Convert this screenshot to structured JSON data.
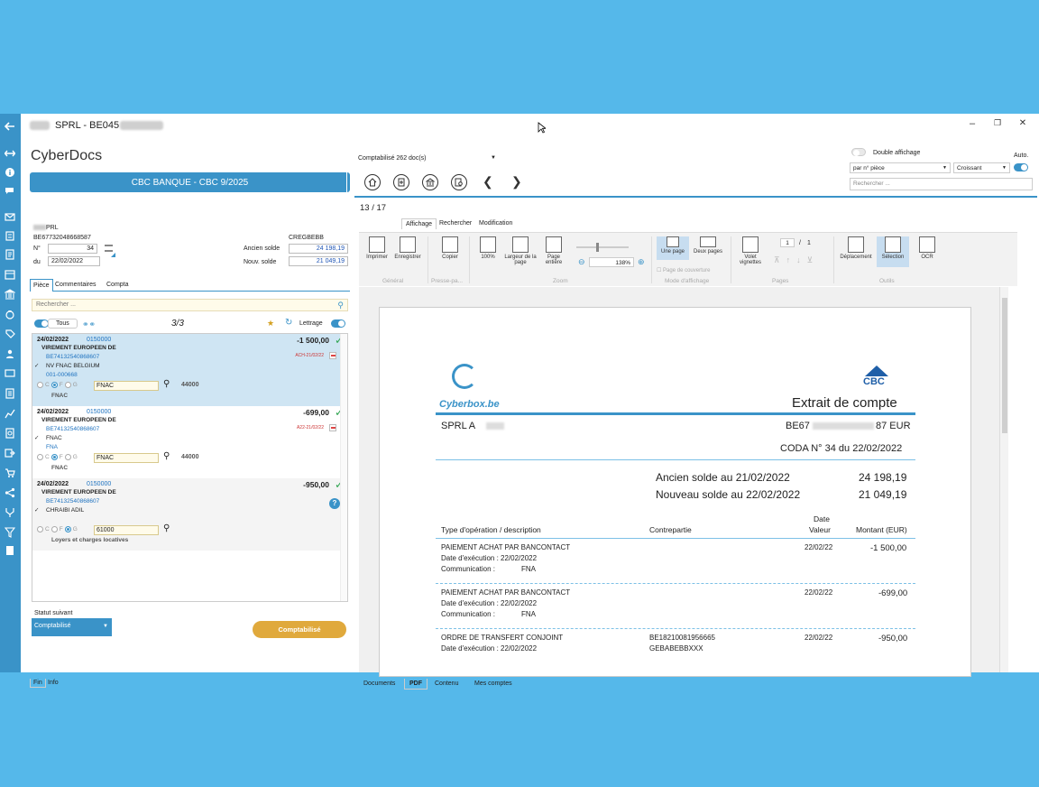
{
  "window": {
    "title_mid": "SPRL - BE045",
    "btn_min": "–",
    "btn_max": "❐",
    "btn_close": "✕"
  },
  "app_name": "CyberDocs",
  "journal": "CBC BANQUE - CBC 9/2025",
  "account": {
    "name": "PRL",
    "iban": "BE67732048668587",
    "bic": "CREGBEBB",
    "no_label": "N°",
    "no_value": "34",
    "du_label": "du",
    "du_value": "22/02/2022",
    "ancien_label": "Ancien solde",
    "ancien_value": "24 198,19",
    "nouv_label": "Nouv. solde",
    "nouv_value": "21 049,19"
  },
  "tabs": [
    "Pièce",
    "Commentaires",
    "Compta"
  ],
  "search_placeholder": "Rechercher ...",
  "filter": {
    "tous": "Tous",
    "counter": "3/3",
    "lettrage": "Lettrage"
  },
  "entries": [
    {
      "date": "24/02/2022",
      "ref": "0150000",
      "amount": "-1 500,00",
      "line1": "VIREMENT EUROPEEN DE",
      "line2": "BE74132540868607",
      "line3": "NV FNAC BELGIUM",
      "line4": "001-000668",
      "tag": "ACH-21/02/22",
      "c": "C",
      "f": "F",
      "g": "G",
      "account": "FNAC",
      "account_no": "44000",
      "label": "FNAC"
    },
    {
      "date": "24/02/2022",
      "ref": "0150000",
      "amount": "-699,00",
      "line1": "VIREMENT EUROPEEN DE",
      "line2": "BE74132540868607",
      "line3": "FNAC",
      "line4": "FNA",
      "tag": "A22-21/02/22",
      "c": "C",
      "f": "F",
      "g": "G",
      "account": "FNAC",
      "account_no": "44000",
      "label": "FNAC"
    },
    {
      "date": "24/02/2022",
      "ref": "0150000",
      "amount": "-950,00",
      "line1": "VIREMENT EUROPEEN DE",
      "line2": "BE74132540868607",
      "line3": "CHRAIBI ADIL",
      "c": "C",
      "f": "F",
      "g": "G",
      "account": "61000",
      "label": "Loyers et charges locatives"
    }
  ],
  "statut": {
    "label": "Statut suivant",
    "value": "Comptabilisé",
    "button": "Comptabilisé"
  },
  "footer_tabs": [
    "Fin",
    "Info"
  ],
  "doccount": "Comptabilisé 262 doc(s)",
  "pagecount": "13 / 17",
  "ribbon_tabs": [
    "Affichage",
    "Rechercher",
    "Modification"
  ],
  "ribbon": {
    "imprimer": "Imprimer",
    "enregistrer": "Enregistrer",
    "copier": "Copier",
    "p100": "100%",
    "largeur": "Largeur de la page",
    "entiere": "Page entière",
    "zoom_value": "138%",
    "une_page": "Une page",
    "deux_pages": "Deux pages",
    "couverture": "Page de couverture",
    "volet": "Volet vignettes",
    "page_num": "1",
    "page_total": "1",
    "deplacement": "Déplacement",
    "selection": "Sélection",
    "ocr": "OCR",
    "g_general": "Général",
    "g_presse": "Presse-pa...",
    "g_zoom": "Zoom",
    "g_mode": "Mode d'affichage",
    "g_pages": "Pages",
    "g_outils": "Outils"
  },
  "rightpanel": {
    "double": "Double affichage",
    "auto": "Auto.",
    "sort": "par n° pièce",
    "order": "Croissant",
    "search": "Rechercher ..."
  },
  "bottom_tabs": [
    "Documents",
    "PDF",
    "Contenu",
    "Mes comptes"
  ],
  "pdf": {
    "brand": "Cyberbox.be",
    "bank": "CBC",
    "title": "Extrait de compte",
    "holder": "SPRL A",
    "iban_a": "BE67",
    "iban_b": "87 EUR",
    "coda": "CODA N° 34 du 22/02/2022",
    "ancien": "Ancien solde au 21/02/2022",
    "ancien_v": "24 198,19",
    "nouveau": "Nouveau solde au 22/02/2022",
    "nouveau_v": "21 049,19",
    "h_type": "Type d'opération / description",
    "h_contre": "Contrepartie",
    "h_date": "Date",
    "h_valeur": "Valeur",
    "h_montant": "Montant (EUR)",
    "rows": [
      {
        "t1": "PAIEMENT ACHAT PAR BANCONTACT",
        "t2": "Date d'exécution : 22/02/2022",
        "t3": "Communication :",
        "t3v": "FNA",
        "contre": "",
        "contre2": "",
        "date": "22/02/22",
        "amt": "-1 500,00"
      },
      {
        "t1": "PAIEMENT ACHAT PAR BANCONTACT",
        "t2": "Date d'exécution : 22/02/2022",
        "t3": "Communication :",
        "t3v": "FNA",
        "contre": "",
        "contre2": "",
        "date": "22/02/22",
        "amt": "-699,00"
      },
      {
        "t1": "ORDRE DE TRANSFERT CONJOINT",
        "t2": "Date d'exécution : 22/02/2022",
        "t3": "",
        "t3v": "",
        "contre": "BE18210081956665",
        "contre2": "GEBABEBBXXX",
        "date": "22/02/22",
        "amt": "-950,00"
      }
    ]
  }
}
